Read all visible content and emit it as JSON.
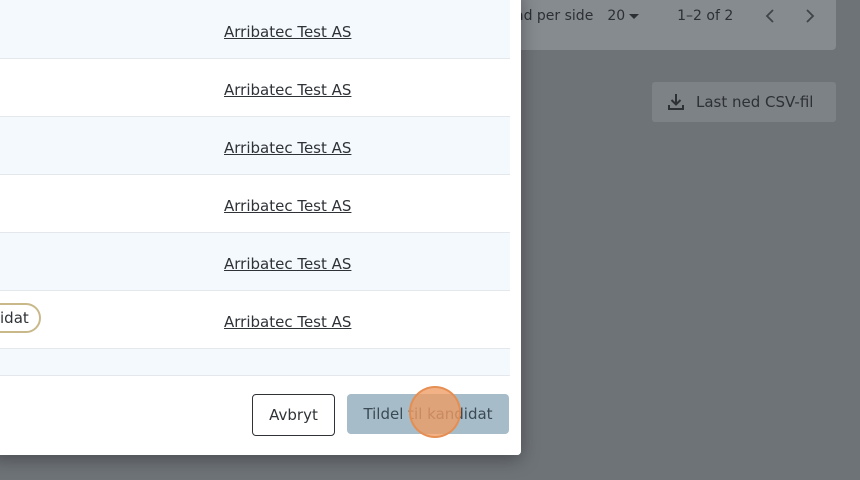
{
  "background": {
    "pager": {
      "rows_label": "ad per side",
      "rows_value": "20",
      "range": "1–2 of 2"
    },
    "csv_button_label": "Last ned CSV-fil"
  },
  "modal": {
    "rows": [
      {
        "company": "Arribatec Test AS"
      },
      {
        "company": "Arribatec Test AS"
      },
      {
        "company": "Arribatec Test AS"
      },
      {
        "company": "Arribatec Test AS"
      },
      {
        "company": "Arribatec Test AS"
      },
      {
        "company": "Arribatec Test AS",
        "chip": "idat"
      }
    ],
    "cancel_label": "Avbryt",
    "assign_label": "Tildel til kandidat"
  },
  "colors": {
    "overlay": "#6e7378",
    "row_alt": "#f4f9fd",
    "assign_button": "#a6bcc8",
    "chip_border": "#c9b98a",
    "click_indicator": "#f09c64"
  }
}
